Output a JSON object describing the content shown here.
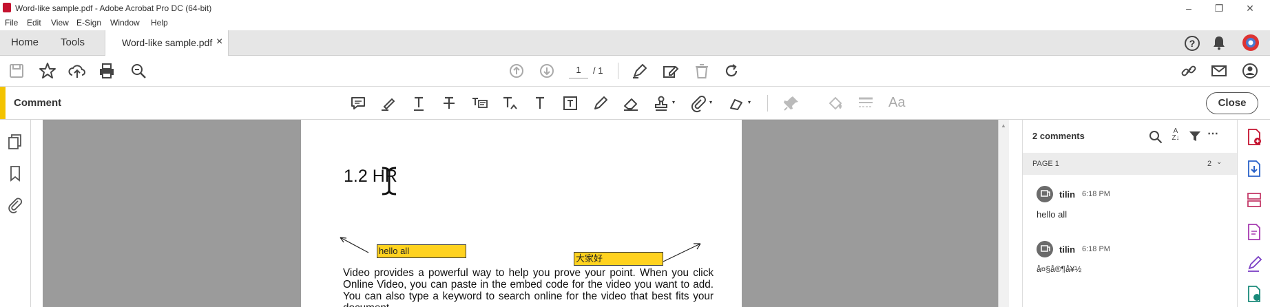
{
  "window": {
    "title": "Word-like sample.pdf - Adobe Acrobat Pro DC (64-bit)"
  },
  "menu": [
    "File",
    "Edit",
    "View",
    "E-Sign",
    "Window",
    "Help"
  ],
  "tabs": {
    "home": "Home",
    "tools": "Tools",
    "document": "Word-like sample.pdf",
    "close_glyph": "×"
  },
  "toolbar": {
    "page_current": "1",
    "page_total": "/ 1"
  },
  "commentbar": {
    "title": "Comment",
    "close_label": "Close",
    "text_style_glyph": "Aa"
  },
  "document": {
    "heading": "1.2 HR",
    "note1": "hello all",
    "note2": "大家好",
    "body": "Video provides a powerful way to help you prove your point. When you click Online Video, you can paste in the embed code for the video you want to add. You can also type a keyword to search online for the video that best fits your document."
  },
  "comments_panel": {
    "count_label": "2 comments",
    "page_label": "PAGE 1",
    "page_count": "2",
    "comments": [
      {
        "author": "tilin",
        "time": "6:18 PM",
        "text": "hello all"
      },
      {
        "author": "tilin",
        "time": "6:18 PM",
        "text": "å¤§å®¶å¥½"
      }
    ]
  },
  "colors": {
    "accent": "#f3c300",
    "note_fill": "#ffd21f",
    "brand_red": "#c4122f",
    "canvas": "#9b9b9b"
  }
}
